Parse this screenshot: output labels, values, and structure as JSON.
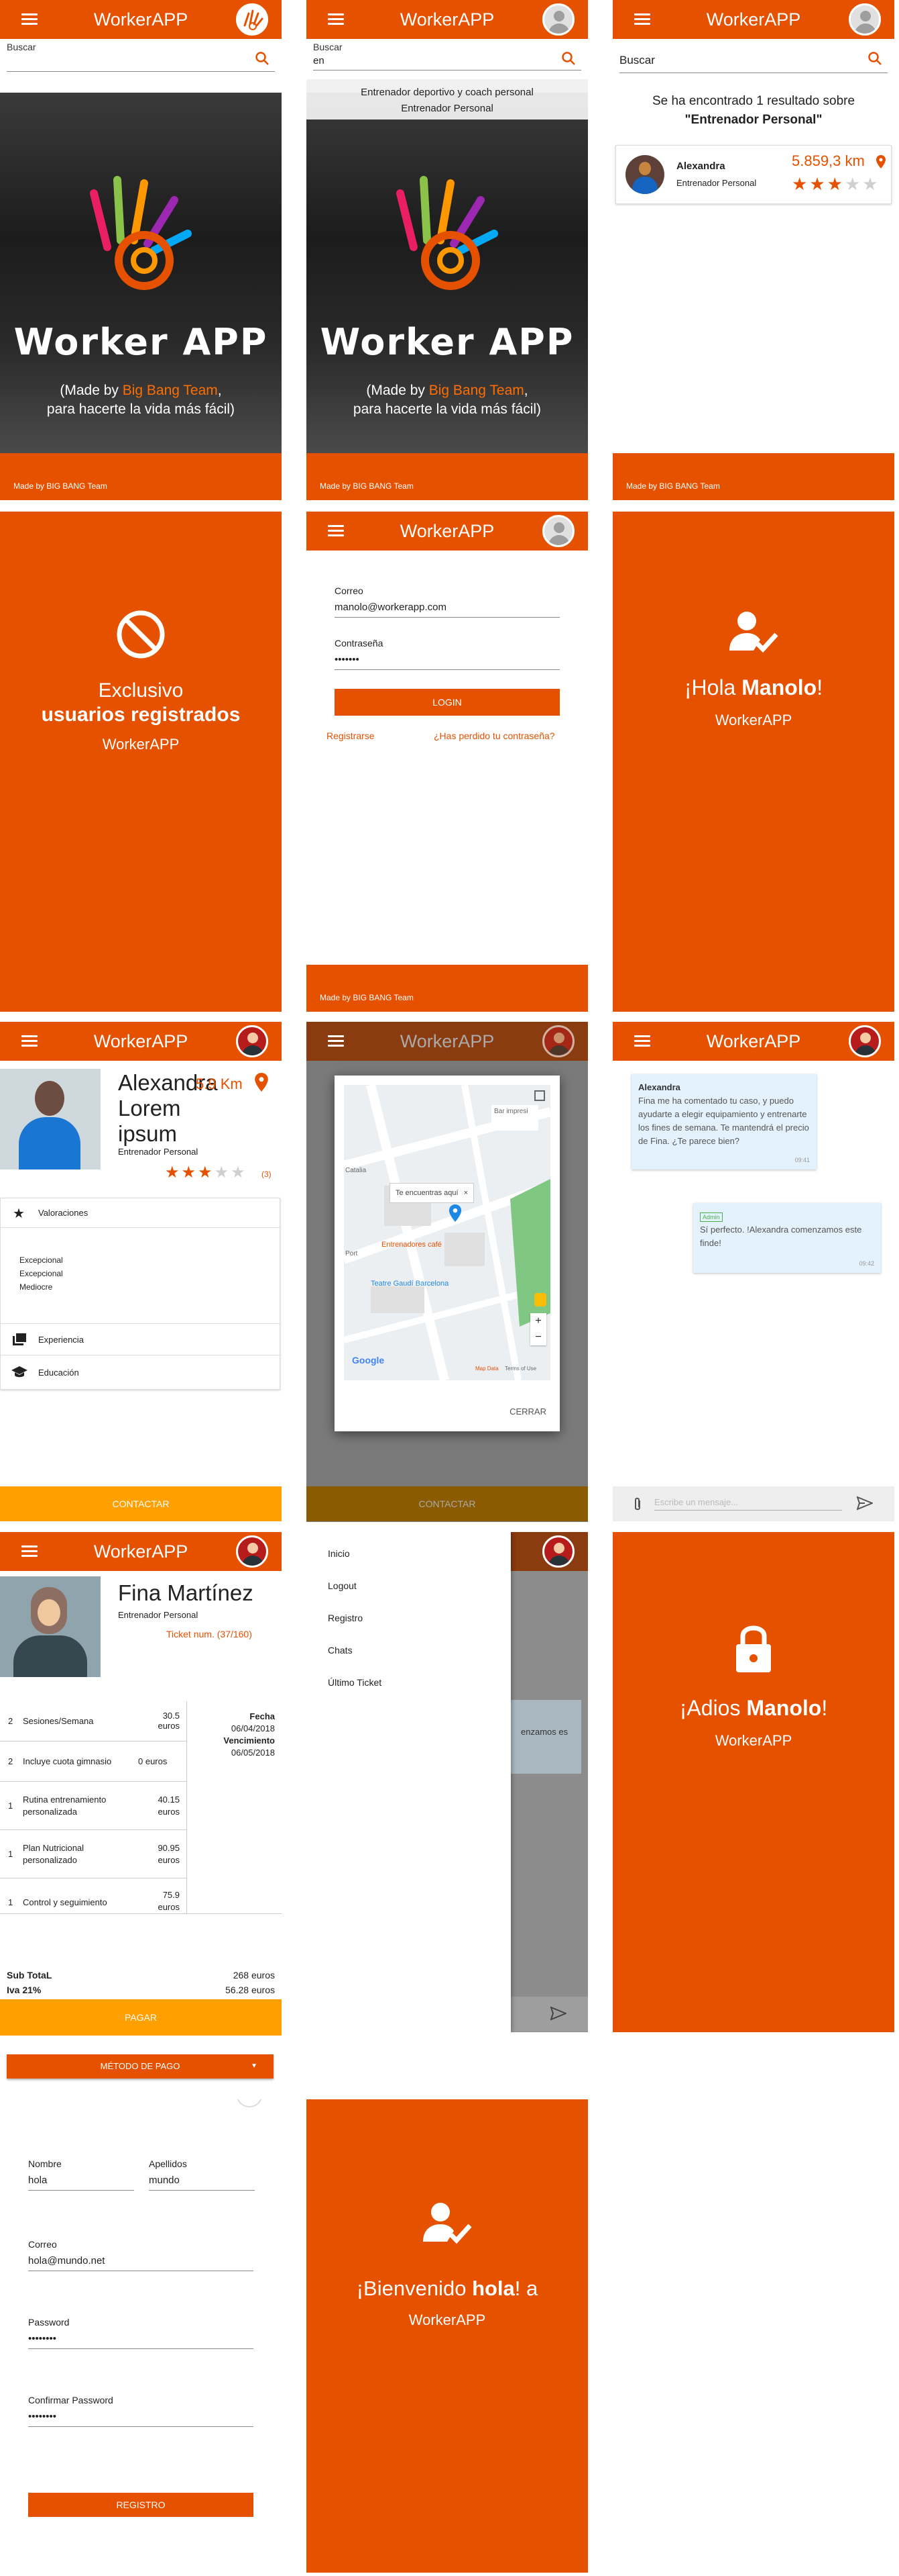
{
  "app": {
    "title": "WorkerAPP",
    "accent_color": "#e65100",
    "footer": "Made by BIG BANG Team"
  },
  "screen_home": {
    "search_label": "Buscar",
    "hero_title": "Worker APP",
    "hero_sub_pre": "(Made by ",
    "hero_sub_link": "Big Bang Team",
    "hero_sub_post": ",",
    "hero_sub_line2": "para hacerte la vida más fácil)"
  },
  "screen_search_typing": {
    "search_label": "Buscar",
    "search_value": "en",
    "suggestion_1": "Entrenador deportivo y coach personal",
    "suggestion_2": "Entrenador Personal"
  },
  "screen_results": {
    "search_label": "Buscar",
    "summary": "Se ha encontrado 1 resultado sobre",
    "query": "\"Entrenador Personal\"",
    "result": {
      "name": "Alexandra",
      "role": "Entrenador Personal",
      "distance": "5.859,3 km",
      "rating": 3,
      "max": 5
    }
  },
  "screen_exclusive": {
    "line1": "Exclusivo",
    "line2": "usuarios registrados",
    "line3": "WorkerAPP"
  },
  "screen_login": {
    "email_label": "Correo",
    "email_value": "manolo@workerapp.com",
    "password_label": "Contraseña",
    "password_value": "•••••••",
    "login_button": "LOGIN",
    "register_link": "Registrarse",
    "forgot_link": "¿Has perdido tu contraseña?"
  },
  "screen_hello": {
    "greeting_pre": "¡Hola ",
    "greeting_name": "Manolo",
    "greeting_post": "!",
    "sub": "WorkerAPP"
  },
  "screen_profile": {
    "name": "Alexandra Lorem ipsum",
    "distance": "5.9 Km",
    "role": "Entrenador Personal",
    "rating": 3,
    "max": 5,
    "reviews": "(3)",
    "section_ratings": "Valoraciones",
    "ratings_list": [
      "Excepcional",
      "Excepcional",
      "Mediocre"
    ],
    "section_experience": "Experiencia",
    "section_education": "Educación",
    "contact_button": "CONTACTAR"
  },
  "screen_map": {
    "tooltip": "Te encuentras aquí",
    "place_1": "Entrenadores café",
    "place_2": "Teatre Gaudí Barcelona",
    "place_3": "Bar impresi",
    "place_4": "Catalia",
    "place_5": "Port",
    "map_data": "Map Data",
    "terms": "Terms of Use",
    "google": "Google",
    "close_button": "CERRAR",
    "contact_button": "CONTACTAR"
  },
  "screen_chat": {
    "msg1_author": "Alexandra",
    "msg1_text": "Fina me ha comentado tu caso, y puedo ayudarte a elegir equipamiento y entrenarte los fines de semana. Te mantendrá el precio de Fina. ¿Te parece bien?",
    "msg1_time": "09:41",
    "msg2_tag": "Admin",
    "msg2_text": "Sí perfecto. !Alexandra comenzamos este finde!",
    "msg2_time": "09:42",
    "input_placeholder": "Escribe un mensaje..."
  },
  "screen_ticket": {
    "name": "Fina Martínez",
    "role": "Entrenador Personal",
    "ticket_label": "Ticket num. (37/160)",
    "rows": [
      {
        "qty": "2",
        "desc": "Sesiones/Semana",
        "price": "30.5 euros"
      },
      {
        "qty": "2",
        "desc": "Incluye cuota gimnasio",
        "price": "0 euros"
      },
      {
        "qty": "1",
        "desc": "Rutina entrenamiento personalizada",
        "price": "40.15 euros"
      },
      {
        "qty": "1",
        "desc": "Plan Nutricional personalizado",
        "price": "90.95 euros"
      },
      {
        "qty": "1",
        "desc": "Control y seguimiento",
        "price": "75.9 euros"
      }
    ],
    "date_label": "Fecha",
    "date_value": "06/04/2018",
    "due_label": "Vencimiento",
    "due_value": "06/05/2018",
    "subtotal_label": "Sub TotaL",
    "subtotal_value": "268 euros",
    "iva_label": "Iva 21%",
    "iva_value": "56.28 euros",
    "pay_button": "PAGAR",
    "method_button": "MÉTODO DE PAGO"
  },
  "screen_drawer": {
    "items": [
      "Inicio",
      "Logout",
      "Registro",
      "Chats",
      "Último Ticket"
    ],
    "bg_text": "enzamos es"
  },
  "screen_goodbye": {
    "greeting_pre": "¡Adios ",
    "greeting_name": "Manolo",
    "greeting_post": "!",
    "sub": "WorkerAPP"
  },
  "screen_register": {
    "name_label": "Nombre",
    "name_value": "hola",
    "surname_label": "Apellidos",
    "surname_value": "mundo",
    "email_label": "Correo",
    "email_value": "hola@mundo.net",
    "password_label": "Password",
    "password_value": "••••••••",
    "confirm_label": "Confirmar Password",
    "confirm_value": "••••••••",
    "register_button": "REGISTRO"
  },
  "screen_welcome": {
    "greeting_pre": "¡Bienvenido ",
    "greeting_name": "hola",
    "greeting_post": "! a",
    "sub": "WorkerAPP"
  }
}
